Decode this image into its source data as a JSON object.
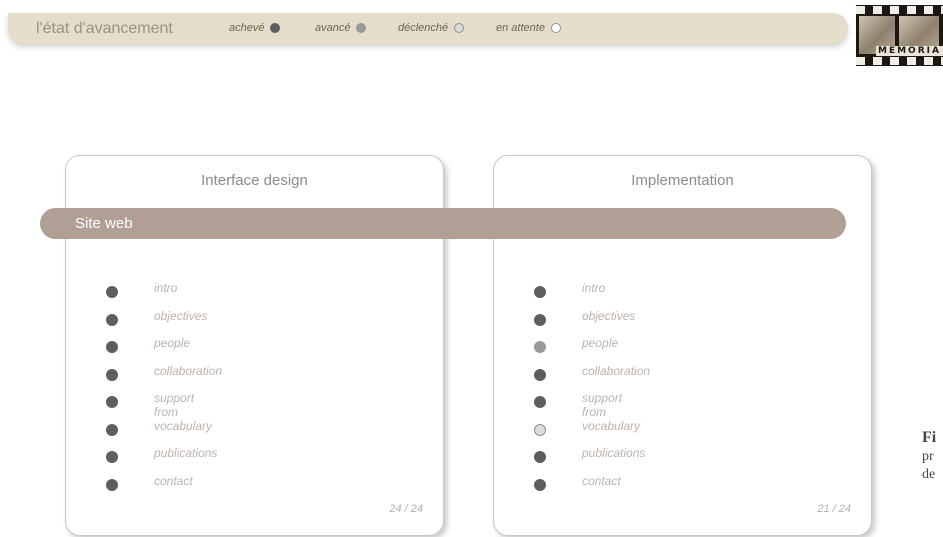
{
  "status": {
    "title": "l'état d'avancement",
    "legend": [
      {
        "label": "achevé",
        "state": "done",
        "color": "#5e5e5e"
      },
      {
        "label": "avancé",
        "state": "advanced",
        "color": "#9a9a9a"
      },
      {
        "label": "déclenché",
        "state": "started",
        "color": "#d9d9d9"
      },
      {
        "label": "en attente",
        "state": "pending",
        "color": "#ffffff"
      }
    ]
  },
  "logo": {
    "text": "MEMORIA"
  },
  "section": {
    "label": "Site web"
  },
  "panels": [
    {
      "title": "Interface design",
      "count": "24 / 24",
      "items": [
        {
          "label": "intro",
          "state": "done"
        },
        {
          "label": "objectives",
          "state": "done"
        },
        {
          "label": "people",
          "state": "done"
        },
        {
          "label": "collaboration",
          "state": "done"
        },
        {
          "label": "support from",
          "state": "done"
        },
        {
          "label": "vocabulary",
          "state": "done"
        },
        {
          "label": "publications",
          "state": "done"
        },
        {
          "label": "contact",
          "state": "done"
        }
      ]
    },
    {
      "title": "Implementation",
      "count": "21 / 24",
      "items": [
        {
          "label": "intro",
          "state": "done"
        },
        {
          "label": "objectives",
          "state": "done"
        },
        {
          "label": "people",
          "state": "advanced"
        },
        {
          "label": "collaboration",
          "state": "done"
        },
        {
          "label": "support from",
          "state": "done"
        },
        {
          "label": "vocabulary",
          "state": "started"
        },
        {
          "label": "publications",
          "state": "done"
        },
        {
          "label": "contact",
          "state": "done"
        }
      ]
    }
  ],
  "caption": {
    "bold": "Fi",
    "line1": "pr",
    "line2": "de"
  },
  "colors": {
    "done": "#5e5e5e",
    "advanced": "#9a9a9a",
    "started": "#dcdcdc",
    "pending": "#ffffff"
  }
}
